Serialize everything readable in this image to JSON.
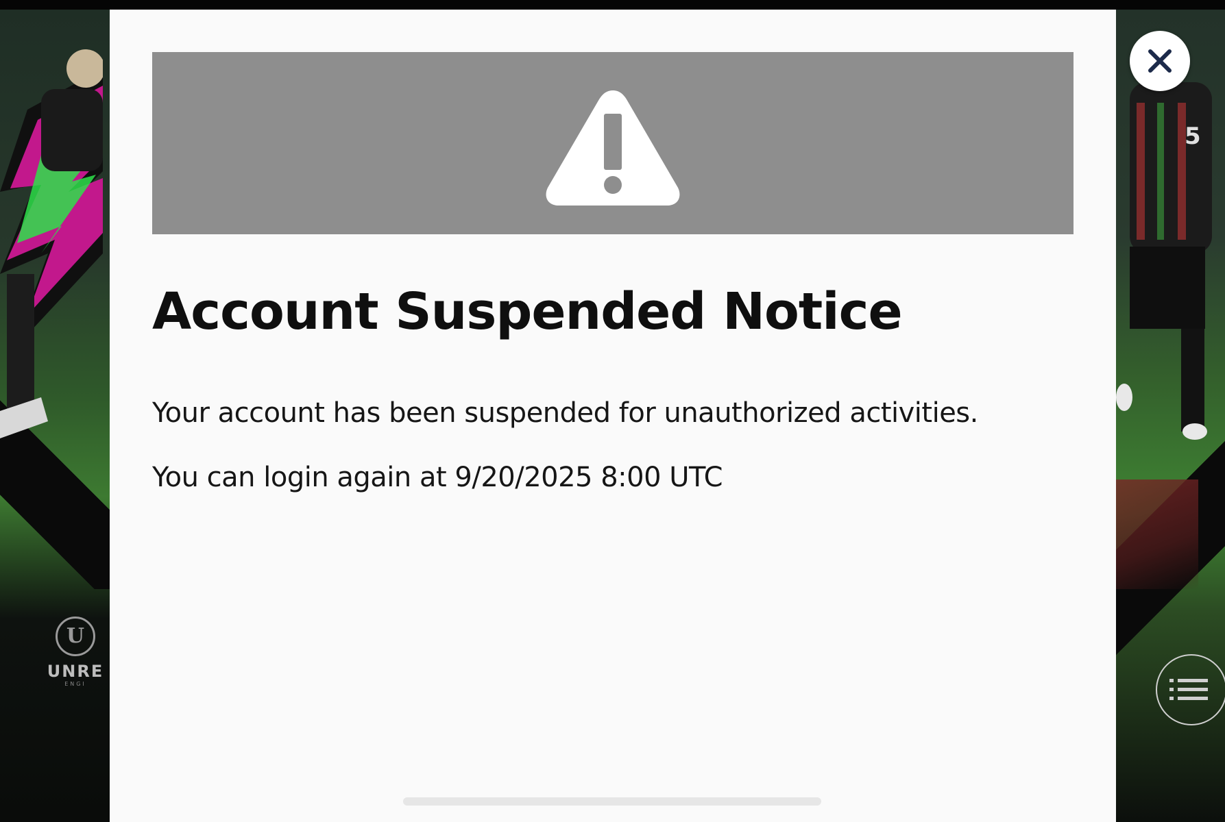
{
  "modal": {
    "title": "Account Suspended Notice",
    "message_line_1": "Your account has been suspended for unauthorized activities.",
    "message_line_2": "You can login again at 9/20/2025 8:00 UTC",
    "banner_icon": "warning-triangle-icon",
    "banner_color": "#8e8e8e"
  },
  "close_button": {
    "icon": "close-icon",
    "icon_color": "#1c2a4a"
  },
  "background": {
    "engine_logo_text": "UNRE",
    "engine_logo_subtext": "ENGI",
    "menu_icon": "menu-list-icon"
  }
}
